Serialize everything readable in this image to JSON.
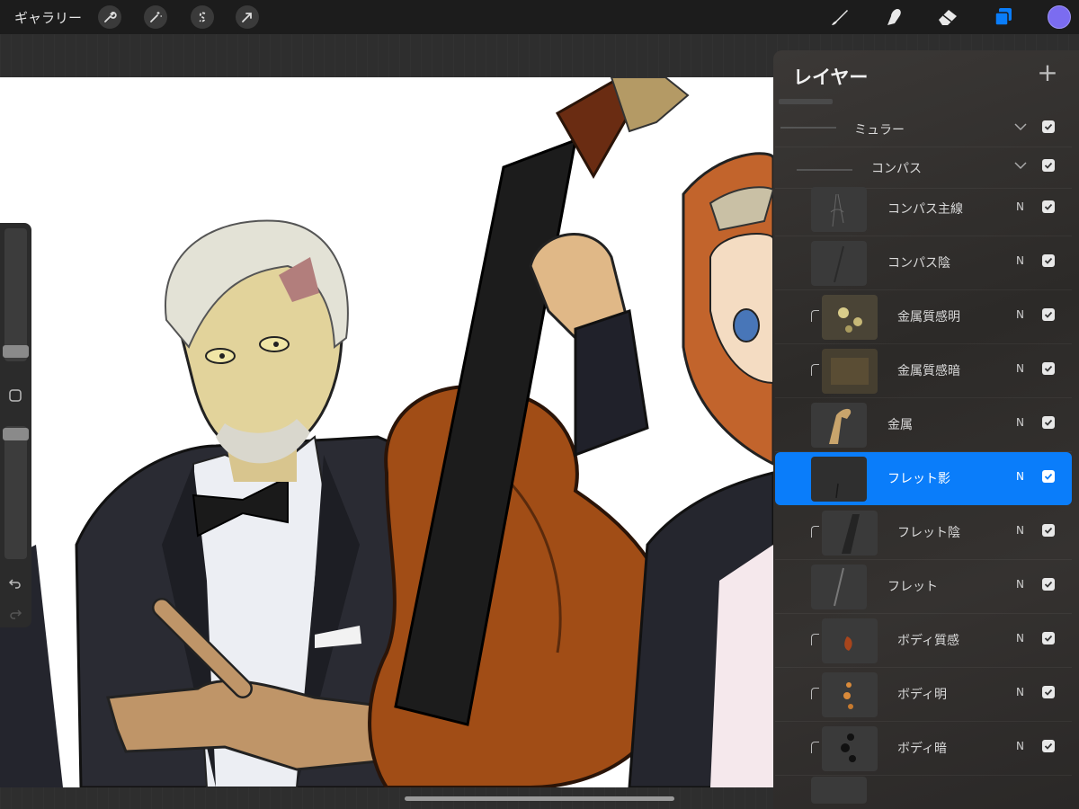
{
  "toolbar": {
    "gallery_label": "ギャラリー",
    "left_tools": [
      "wrench-icon",
      "magic-wand-icon",
      "selection-s-icon",
      "transform-arrow-icon"
    ],
    "right_tools": [
      "brush-icon",
      "smudge-icon",
      "eraser-icon",
      "layers-icon"
    ],
    "accent_color": "#0a7dfa",
    "current_color": "#7b6cf0"
  },
  "layers_panel": {
    "title": "レイヤー",
    "add_icon": "+",
    "rows": [
      {
        "name": "ミュラー",
        "kind": "group",
        "mode": "",
        "visible": true
      },
      {
        "name": "コンパス",
        "kind": "group",
        "mode": "",
        "visible": true
      },
      {
        "name": "コンパス主線",
        "kind": "layer",
        "mode": "N",
        "visible": true
      },
      {
        "name": "コンパス陰",
        "kind": "layer",
        "mode": "N",
        "visible": true
      },
      {
        "name": "金属質感明",
        "kind": "clipped",
        "mode": "N",
        "visible": true
      },
      {
        "name": "金属質感暗",
        "kind": "clipped",
        "mode": "N",
        "visible": true
      },
      {
        "name": "金属",
        "kind": "layer",
        "mode": "N",
        "visible": true
      },
      {
        "name": "フレット影",
        "kind": "layer",
        "mode": "N",
        "visible": true,
        "selected": true
      },
      {
        "name": "フレット陰",
        "kind": "clipped",
        "mode": "N",
        "visible": true
      },
      {
        "name": "フレット",
        "kind": "layer",
        "mode": "N",
        "visible": true
      },
      {
        "name": "ボディ質感",
        "kind": "clipped",
        "mode": "N",
        "visible": true
      },
      {
        "name": "ボディ明",
        "kind": "clipped",
        "mode": "N",
        "visible": true
      },
      {
        "name": "ボディ暗",
        "kind": "clipped",
        "mode": "N",
        "visible": true
      }
    ]
  }
}
